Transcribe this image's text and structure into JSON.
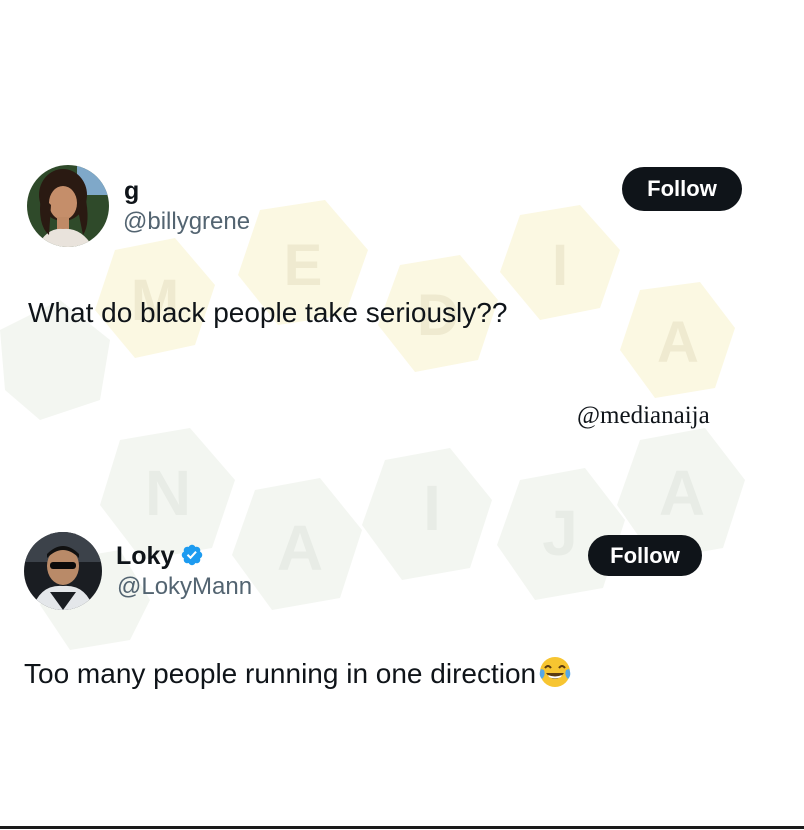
{
  "tweets": [
    {
      "display_name": "g",
      "handle": "@billygrene",
      "follow_label": "Follow",
      "text": "What do black people take seriously??",
      "verified": false
    },
    {
      "display_name": "Loky",
      "handle": "@LokyMann",
      "follow_label": "Follow",
      "text": "Too many people running in one direction",
      "verified": true,
      "emoji": "face-with-tears-of-joy"
    }
  ],
  "credit": "@medianaija",
  "watermark": {
    "top_letters": [
      "M",
      "E",
      "D",
      "I",
      "A"
    ],
    "bottom_letters": [
      "N",
      "A",
      "I",
      "J",
      "A"
    ]
  },
  "colors": {
    "follow_bg": "#0f1419",
    "follow_text": "#ffffff",
    "handle": "#536471",
    "verified_badge": "#1d9bf0",
    "watermark_top": "#fbf7de",
    "watermark_bottom": "#f2f5f0"
  }
}
